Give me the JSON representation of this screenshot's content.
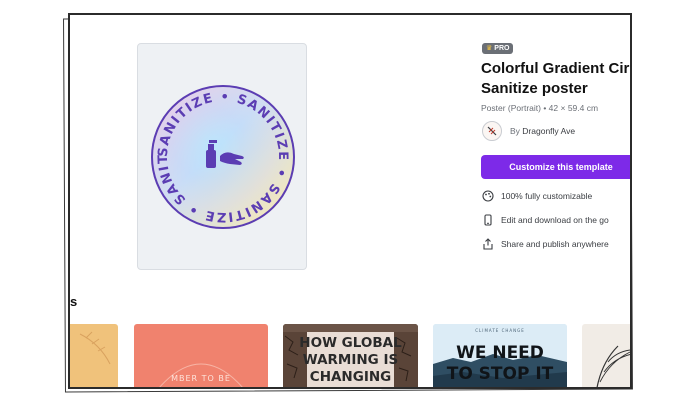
{
  "template": {
    "badge": "PRO",
    "title_line1": "Colorful Gradient Cir",
    "title_line2": "Sanitize poster",
    "meta": "Poster (Portrait) • 42 × 59.4 cm",
    "author_prefix": "By",
    "author_name": "Dragonfly Ave",
    "cta_label": "Customize this template",
    "preview_text": "SANITIZE • SANITIZE • SANITIZE • SANITIZE •"
  },
  "features": [
    {
      "icon": "palette-icon",
      "label": "100% fully customizable"
    },
    {
      "icon": "phone-icon",
      "label": "Edit and download on the go"
    },
    {
      "icon": "share-icon",
      "label": "Share and publish anywhere"
    }
  ],
  "related": {
    "heading": "s",
    "thumbs": [
      {
        "text": ""
      },
      {
        "text": "MBER TO BE"
      },
      {
        "text_line1": "HOW GLOBAL",
        "text_line2": "WARMING IS",
        "text_line3": "CHANGING"
      },
      {
        "small": "CLIMATE CHANGE",
        "text_line1": "WE NEED",
        "text_line2": "TO STOP IT"
      },
      {
        "text": ""
      }
    ]
  },
  "colors": {
    "accent": "#7d2ae8",
    "ring": "#5b3db3"
  }
}
